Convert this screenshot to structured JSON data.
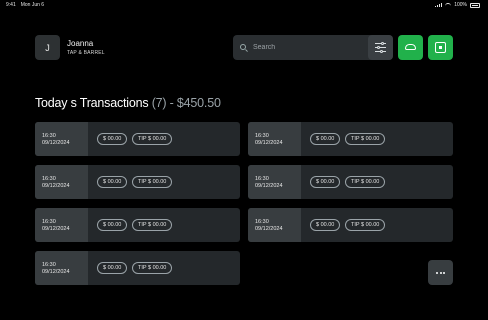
{
  "status_bar": {
    "time": "9:41",
    "date": "Mon Jun 6",
    "battery": "100%"
  },
  "user": {
    "initial": "J",
    "name": "Joanna",
    "org": "TAP & BARREL"
  },
  "search": {
    "placeholder": "Search"
  },
  "header": {
    "title_main": "Today s Transactions",
    "count": "(7)",
    "total": "- $450.50"
  },
  "transactions": [
    {
      "time": "16:30",
      "date": "09/12/2024",
      "amount": "$ 00.00",
      "tip": "TIP $ 00.00"
    },
    {
      "time": "16:30",
      "date": "09/12/2024",
      "amount": "$ 00.00",
      "tip": "TIP $ 00.00"
    },
    {
      "time": "16:30",
      "date": "09/12/2024",
      "amount": "$ 00.00",
      "tip": "TIP $ 00.00"
    },
    {
      "time": "16:30",
      "date": "09/12/2024",
      "amount": "$ 00.00",
      "tip": "TIP $ 00.00"
    },
    {
      "time": "16:30",
      "date": "09/12/2024",
      "amount": "$ 00.00",
      "tip": "TIP $ 00.00"
    },
    {
      "time": "16:30",
      "date": "09/12/2024",
      "amount": "$ 00.00",
      "tip": "TIP $ 00.00"
    },
    {
      "time": "16:30",
      "date": "09/12/2024",
      "amount": "$ 00.00",
      "tip": "TIP $ 00.00"
    }
  ],
  "icons": {
    "search": "search-icon",
    "filter": "sliders-icon",
    "cloud": "cloud-icon",
    "square": "square-icon",
    "more": "more-horizontal-icon"
  },
  "colors": {
    "accent": "#21b14b",
    "background": "#000000",
    "card": "#24282b",
    "card_time": "#383d40",
    "muted_text": "#9aa3a8"
  }
}
